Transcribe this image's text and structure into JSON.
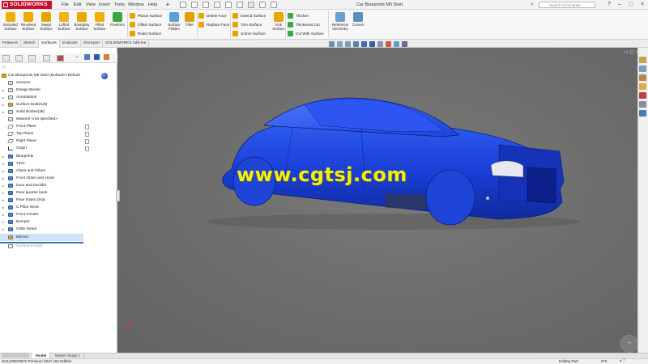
{
  "app": {
    "name": "SOLIDWORKS",
    "version_status": "SOLIDWORKS Premium 2017 x64 Edition"
  },
  "menu": [
    "File",
    "Edit",
    "View",
    "Insert",
    "Tools",
    "Window",
    "Help"
  ],
  "document_title": "Car Blueprints M5 Start",
  "search": {
    "placeholder": "Search Commands"
  },
  "ribbon": {
    "large_buttons": [
      {
        "label": "Extruded Surface",
        "icon": "extruded-surface-icon"
      },
      {
        "label": "Revolved Surface",
        "icon": "revolved-surface-icon"
      },
      {
        "label": "Swept Surface",
        "icon": "swept-surface-icon"
      },
      {
        "label": "Lofted Surface",
        "icon": "lofted-surface-icon"
      },
      {
        "label": "Boundary Surface",
        "icon": "boundary-surface-icon"
      },
      {
        "label": "Filled Surface",
        "icon": "filled-surface-icon"
      },
      {
        "label": "Freeform",
        "icon": "freeform-icon"
      }
    ],
    "group1": [
      "Planar Surface",
      "Offset Surface",
      "Ruled Surface"
    ],
    "flatten": "Surface Flatten",
    "fillet": "Fillet",
    "group2": [
      "Delete Face",
      "Replace Face"
    ],
    "group3": [
      "Extend Surface",
      "Trim Surface",
      "Untrim Surface"
    ],
    "knit": "Knit Surface",
    "group4": [
      "Thicken",
      "Thickened Cut",
      "Cut With Surface"
    ],
    "ref_geometry": "Reference Geometry",
    "curves": "Curves"
  },
  "tabs": [
    "Features",
    "Sketch",
    "Surfaces",
    "Evaluate",
    "DimXpert",
    "SOLIDWORKS Add-Ins"
  ],
  "active_tab": "Surfaces",
  "tree": {
    "root": "Car Blueprints M5 Start  (Default<<Default",
    "items": [
      {
        "label": "Sensors",
        "icon": "sensor-icon"
      },
      {
        "label": "Design Binder",
        "icon": "design-binder-icon"
      },
      {
        "label": "Annotations",
        "icon": "annotations-icon"
      },
      {
        "label": "Surface Bodies(8)",
        "icon": "surface-bodies-icon"
      },
      {
        "label": "Solid Bodies(38)",
        "icon": "solid-bodies-icon"
      },
      {
        "label": "Material <not specified>",
        "icon": "material-icon"
      },
      {
        "label": "Front Plane",
        "icon": "plane-icon"
      },
      {
        "label": "Top Plane",
        "icon": "plane-icon"
      },
      {
        "label": "Right Plane",
        "icon": "plane-icon"
      },
      {
        "label": "Origin",
        "icon": "origin-icon"
      },
      {
        "label": "Blueprints",
        "icon": "folder-icon"
      },
      {
        "label": "Tires",
        "icon": "folder-icon"
      },
      {
        "label": "Glass and Pillars",
        "icon": "folder-icon"
      },
      {
        "label": "Front Glass and Hood",
        "icon": "folder-icon"
      },
      {
        "label": "Door and Decklid",
        "icon": "folder-icon"
      },
      {
        "label": "Rear quarter back",
        "icon": "folder-icon"
      },
      {
        "label": "Rear Glass Drop",
        "icon": "folder-icon"
      },
      {
        "label": "C Pillar Work",
        "icon": "folder-icon"
      },
      {
        "label": "Front Fender",
        "icon": "folder-icon"
      },
      {
        "label": "Bumper",
        "icon": "folder-icon"
      },
      {
        "label": "Grille Detail",
        "icon": "folder-icon"
      },
      {
        "label": "Mirror2",
        "icon": "folder-icon"
      },
      {
        "label": "Surface-Knit(8)",
        "icon": "knit-icon"
      }
    ]
  },
  "bottom_tabs": [
    "Model",
    "Motion Study 1"
  ],
  "active_bottom_tab": "Model",
  "status": {
    "mode": "Editing Part",
    "units": "IPS"
  },
  "watermark": "www.cgtsj.com",
  "colors": {
    "car_body": "#1a3fd6",
    "watermark": "#f4f200",
    "brand_red": "#c8102e",
    "viewport": "#6b6b6b"
  }
}
